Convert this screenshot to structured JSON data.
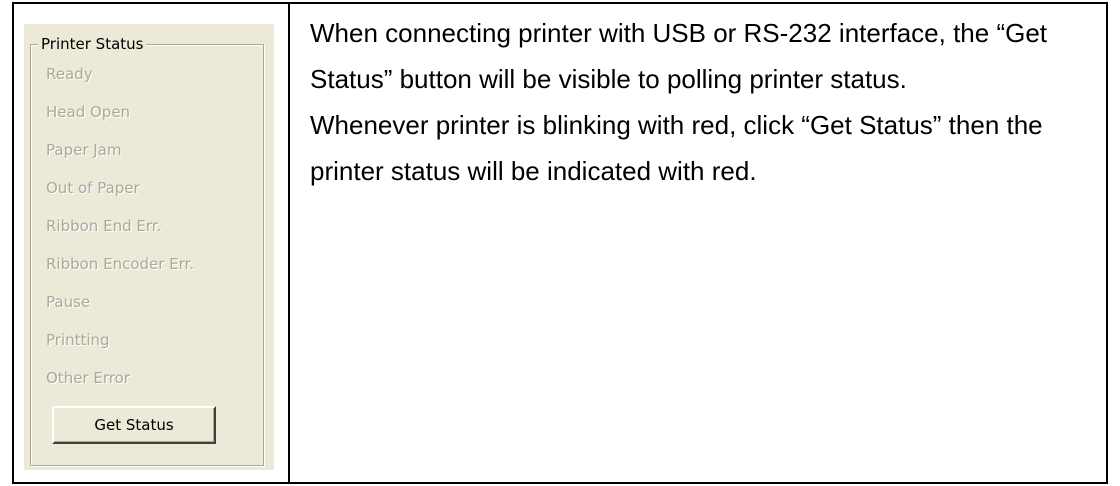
{
  "printer_status": {
    "title": "Printer Status",
    "items": [
      "Ready",
      "Head Open",
      "Paper Jam",
      "Out of Paper",
      "Ribbon End Err.",
      "Ribbon Encoder Err.",
      "Pause",
      "Printting",
      "Other Error"
    ],
    "button_label": "Get Status"
  },
  "description": {
    "paragraph1": "When connecting printer with USB or RS-232 interface, the “Get Status” button will be visible to polling printer status.",
    "paragraph2": "Whenever printer is blinking with red, click “Get Status” then the printer status will be indicated with red."
  }
}
